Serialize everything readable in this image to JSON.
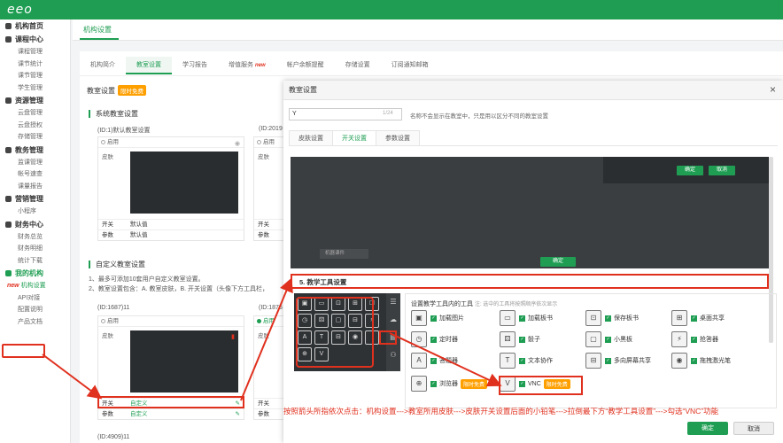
{
  "app": {
    "logo": "eeo"
  },
  "sidebar": {
    "sections": [
      {
        "title": "机构首页",
        "items": []
      },
      {
        "title": "课程中心",
        "items": [
          "课程管理",
          "课节统计",
          "课节管理",
          "学生管理"
        ]
      },
      {
        "title": "资源管理",
        "items": [
          "云盘管理",
          "云盘授权",
          "存储管理"
        ]
      },
      {
        "title": "教务管理",
        "items": [
          "监课管理",
          "帐号速查",
          "课量报告"
        ]
      },
      {
        "title": "营销管理",
        "items": [
          "小程序"
        ]
      },
      {
        "title": "财务中心",
        "items": [
          "财务总览",
          "财务明细",
          "统计下载"
        ]
      },
      {
        "title": "我的机构",
        "items": [
          "机构设置",
          "API对接",
          "配置说明",
          "产品文档"
        ]
      }
    ],
    "new_tag": "new"
  },
  "breadcrumb": "机构设置",
  "main": {
    "tabs": [
      "机构简介",
      "教室设置",
      "学习报告",
      "增值服务",
      "帐户余额提醒",
      "存储设置",
      "订阅通知邮箱"
    ],
    "tab_new_tag": "new",
    "title": "教室设置",
    "title_badge": "限时免费",
    "system_heading": "系统教室设置",
    "card1_id": "(ID:1)默认教室设置",
    "card2_id": "(ID:2019",
    "enabled": "启用",
    "skin": "皮肤",
    "switch": "开关",
    "params": "参数",
    "default_value": "默认值",
    "custom_heading": "自定义教室设置",
    "note1": "1、最多可添加10套用户自定义教室设置。",
    "note2": "2、教室设置包含：A. 教室皮肤，B. 开关设置（头像下方工具栏，",
    "card3_id": "(ID:1687)11",
    "card4_id": "(ID:1875",
    "custom_value": "自定义",
    "card5_id": "(ID:4909)11"
  },
  "modal": {
    "title": "教室设置",
    "close": "×",
    "name_value": "Y",
    "name_count": "1/24",
    "name_hint": "名称不会显示在教室中，只是用以区分不同的教室设置",
    "tabs": [
      "皮肤设置",
      "开关设置",
      "参数设置"
    ],
    "preview_ok": "确定",
    "preview_cancel": "取消",
    "preview_left_text": "机器课件",
    "preview_bottom_ok": "确定",
    "section5_title": "5. 教学工具设置",
    "tools_heading": "设置教学工具内的工具",
    "tools_hint": "注: 选中的工具将按照顺序依次显示",
    "tools": [
      {
        "icon": "image-icon",
        "glyph": "▣",
        "label": "加载图片",
        "checked": true
      },
      {
        "icon": "folder-icon",
        "glyph": "▭",
        "label": "加载板书",
        "checked": true
      },
      {
        "icon": "save-icon",
        "glyph": "⊡",
        "label": "保存板书",
        "checked": true
      },
      {
        "icon": "desktop-icon",
        "glyph": "⊞",
        "label": "桌面共享",
        "checked": true
      },
      {
        "icon": "timer-icon",
        "glyph": "◷",
        "label": "定时器",
        "checked": true
      },
      {
        "icon": "dice-icon",
        "glyph": "⚄",
        "label": "骰子",
        "checked": true
      },
      {
        "icon": "blackboard-icon",
        "glyph": "▢",
        "label": "小黑板",
        "checked": true
      },
      {
        "icon": "answer-icon",
        "glyph": "⚡",
        "label": "抢答器",
        "checked": true
      },
      {
        "icon": "quiz-icon",
        "glyph": "A",
        "label": "答题器",
        "checked": true
      },
      {
        "icon": "text-collab-icon",
        "glyph": "T",
        "label": "文本协作",
        "checked": true
      },
      {
        "icon": "multi-screen-icon",
        "glyph": "⊟",
        "label": "多向屏幕共享",
        "checked": true
      },
      {
        "icon": "laser-icon",
        "glyph": "◉",
        "label": "拖拽激光笔",
        "checked": true
      },
      {
        "icon": "browser-icon",
        "glyph": "⊕",
        "label": "浏览器",
        "checked": true,
        "badge": "限时免费"
      },
      {
        "icon": "vnc-icon",
        "glyph": "V",
        "label": "VNC",
        "checked": true,
        "badge": "限时免费"
      }
    ],
    "toolbox_cells": [
      "▣",
      "▭",
      "⊡",
      "⊞",
      "☐",
      "◷",
      "⚄",
      "▢",
      "⊟",
      "⚡",
      "A",
      "T",
      "⊟",
      "◉",
      "",
      "⊕",
      "V"
    ],
    "toolbox_side": [
      "☰",
      "☁",
      "▤",
      "⚇"
    ],
    "instruction": "按照箭头所指依次点击：机构设置--->教室所用皮肤--->皮肤开关设置后面的小铅笔--->拉倒最下方“教学工具设置”--->勾选“VNC”功能",
    "ok": "确定",
    "cancel": "取消"
  },
  "colors": {
    "brand": "#1f9e53",
    "annotation": "#e0301e",
    "badge": "#ff9f00"
  }
}
